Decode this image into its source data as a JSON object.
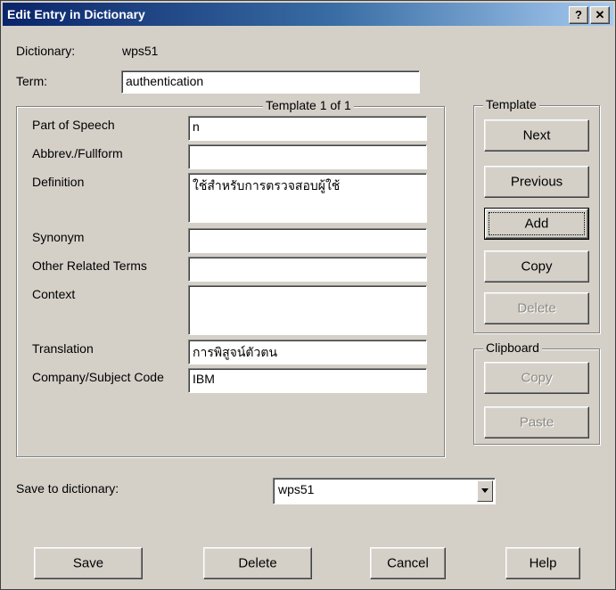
{
  "window": {
    "title": "Edit Entry in Dictionary",
    "help_glyph": "?",
    "close_glyph": "✕"
  },
  "dictionary": {
    "label": "Dictionary:",
    "value": "wps51"
  },
  "term": {
    "label": "Term:",
    "value": "authentication"
  },
  "template_panel": {
    "legend": "Template 1 of 1",
    "fields": {
      "part_of_speech": {
        "label": "Part of Speech",
        "value": "n"
      },
      "abbrev": {
        "label": "Abbrev./Fullform",
        "value": ""
      },
      "definition": {
        "label": "Definition",
        "value": "ใช้สำหรับการตรวจสอบผู้ใช้"
      },
      "synonym": {
        "label": "Synonym",
        "value": ""
      },
      "other_terms": {
        "label": "Other Related Terms",
        "value": ""
      },
      "context": {
        "label": "Context",
        "value": ""
      },
      "translation": {
        "label": "Translation",
        "value": "การพิสูจน์ตัวตน"
      },
      "company_code": {
        "label": "Company/Subject Code",
        "value": "IBM"
      }
    }
  },
  "template_group": {
    "legend": "Template",
    "next": "Next",
    "previous": "Previous",
    "add": "Add",
    "copy": "Copy",
    "delete": "Delete"
  },
  "clipboard_group": {
    "legend": "Clipboard",
    "copy": "Copy",
    "paste": "Paste"
  },
  "save_to": {
    "label": "Save to dictionary:",
    "value": "wps51"
  },
  "footer": {
    "save": "Save",
    "delete": "Delete",
    "cancel": "Cancel",
    "help": "Help"
  }
}
